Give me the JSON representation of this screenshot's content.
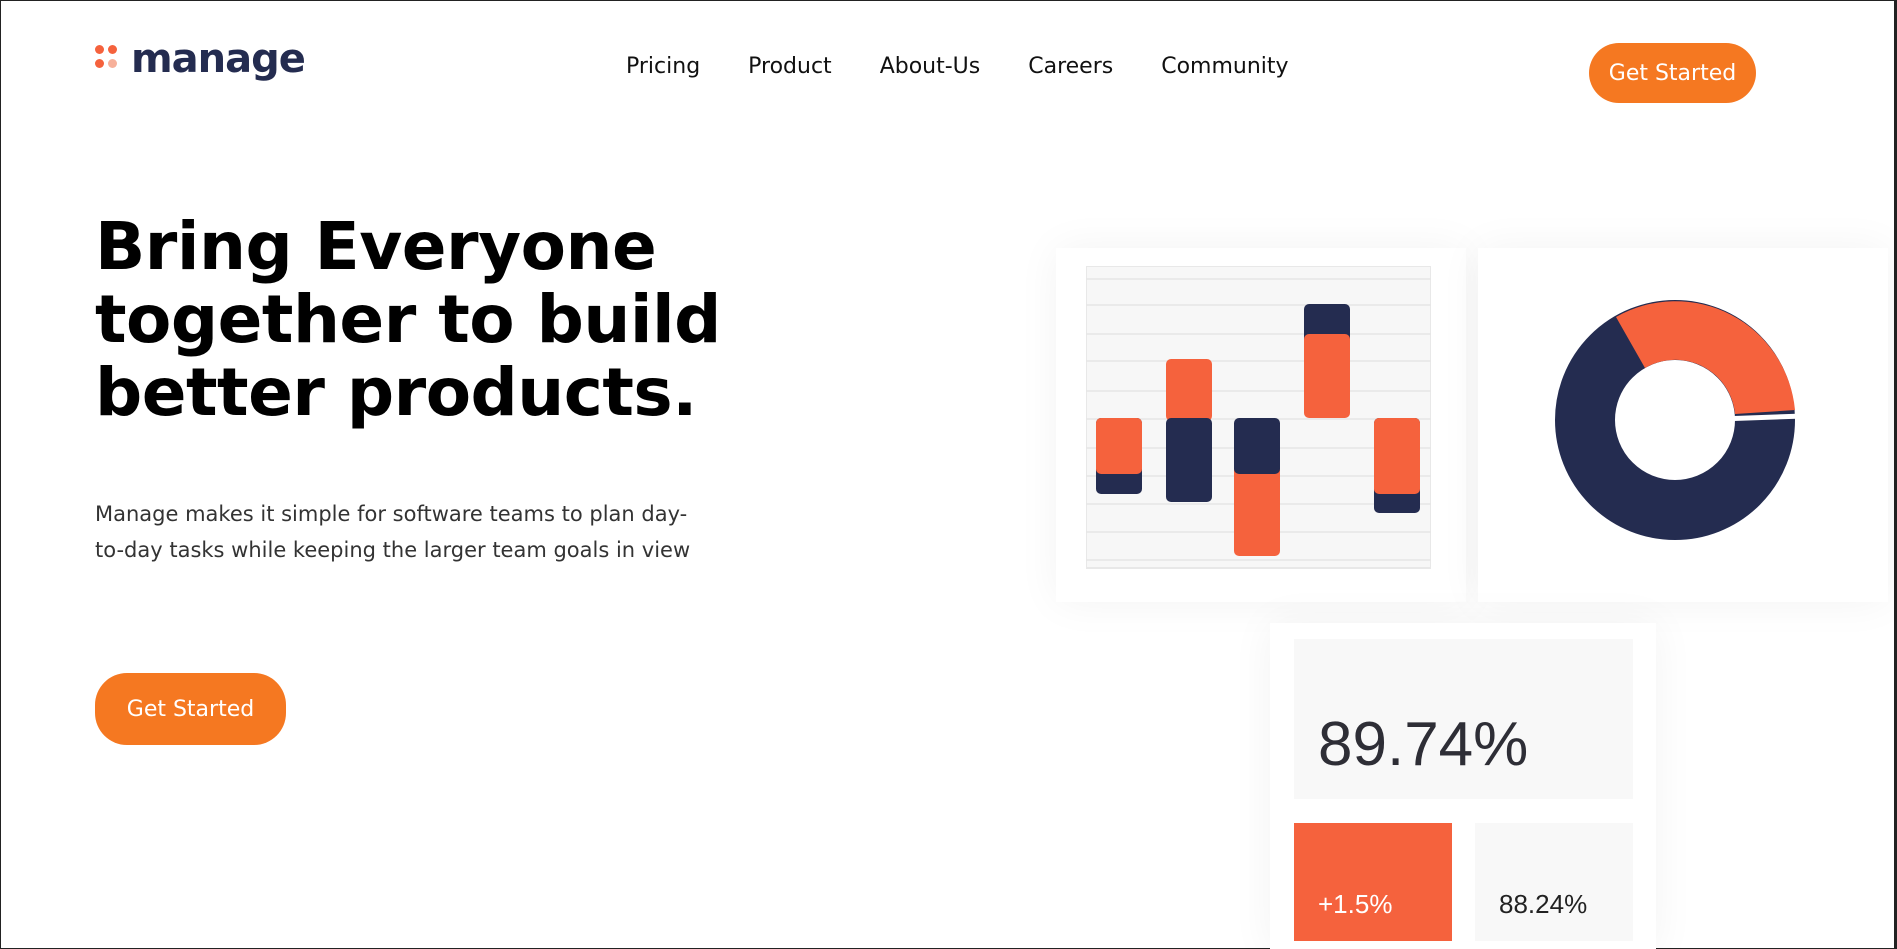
{
  "header": {
    "logo_text": "manage",
    "nav": [
      "Pricing",
      "Product",
      "About-Us",
      "Careers",
      "Community"
    ],
    "cta_label": "Get Started"
  },
  "hero": {
    "title": "Bring Everyone together to build better products.",
    "subtitle": "Manage makes it simple for software teams to plan day-to-day tasks while keeping the larger team goals in view",
    "cta_label": "Get Started"
  },
  "stats": {
    "main": "89.74%",
    "change": "+1.5%",
    "secondary": "88.24%"
  },
  "colors": {
    "brand_orange": "#f57821",
    "chart_coral": "#f5623d",
    "chart_navy": "#242c50"
  },
  "icons": {
    "logo_mark": "four-dot-logo-icon"
  }
}
